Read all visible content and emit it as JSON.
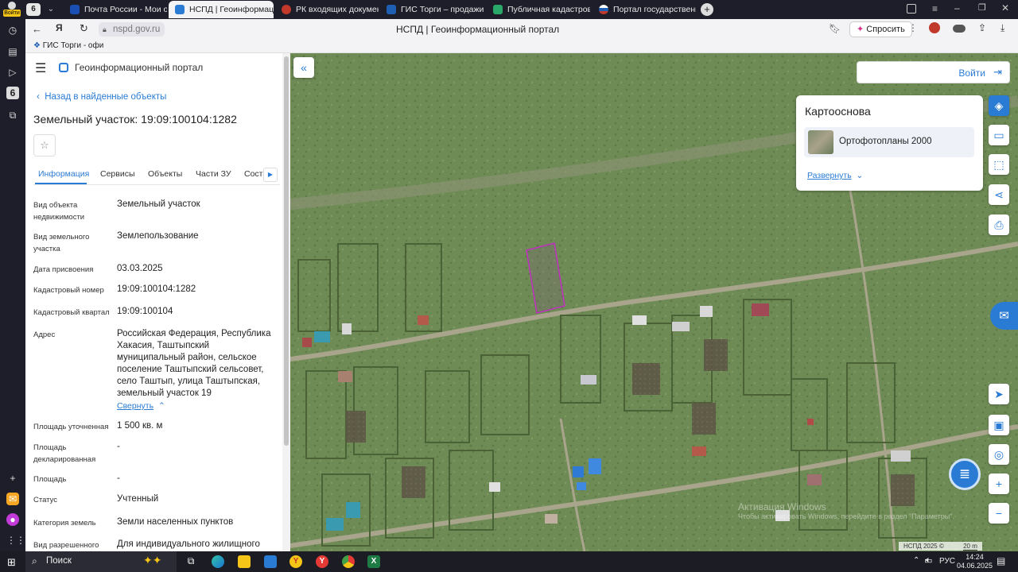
{
  "browser": {
    "tabs": [
      {
        "label": "Почта России - Мои отпр",
        "color": "#1a4fb5"
      },
      {
        "label": "НСПД | Геоинформаци",
        "color": "#2a7bd4",
        "active": true
      },
      {
        "label": "РК входящих документов",
        "color": "#c0392b"
      },
      {
        "label": "ГИС Торги – продажи гос",
        "color": "#1e5fb3"
      },
      {
        "label": "Публичная кадастровая",
        "color": "#2aa86a"
      },
      {
        "label": "Портал государственных",
        "color": "#c0392b"
      }
    ],
    "url": "nspd.gov.ru",
    "title": "НСПД | Геоинформационный портал",
    "ask_label": "Спросить",
    "bookmark": "ГИС Торги - офи",
    "profile_badge": "Войти",
    "tab_count": "6"
  },
  "portal": {
    "name": "Геоинформационный портал",
    "back_link": "Назад в найденные объекты",
    "object_title": "Земельный участок: 19:09:100104:1282",
    "tabs": [
      "Информация",
      "Сервисы",
      "Объекты",
      "Части ЗУ",
      "Соста"
    ],
    "fields": [
      {
        "label": "Вид объекта недвижимости",
        "value": "Земельный участок"
      },
      {
        "label": "Вид земельного участка",
        "value": "Землепользование"
      },
      {
        "label": "Дата присвоения",
        "value": "03.03.2025"
      },
      {
        "label": "Кадастровый номер",
        "value": "19:09:100104:1282"
      },
      {
        "label": "Кадастровый квартал",
        "value": "19:09:100104"
      },
      {
        "label": "Адрес",
        "value": "Российская Федерация, Республика Хакасия, Таштыпский муниципальный район, сельское поселение Таштыпский сельсовет, село Таштып, улица Таштыпская, земельный участок 19"
      },
      {
        "label": "Площадь уточненная",
        "value": "1 500 кв. м"
      },
      {
        "label": "Площадь декларированная",
        "value": "-"
      },
      {
        "label": "Площадь",
        "value": "-"
      },
      {
        "label": "Статус",
        "value": "Учтенный"
      },
      {
        "label": "Категория земель",
        "value": "Земли населенных пунктов"
      },
      {
        "label": "Вид разрешенного",
        "value": "Для индивидуального жилищного"
      }
    ],
    "collapse_link": "Свернуть"
  },
  "map": {
    "login_label": "Войти",
    "basemap_title": "Картооснова",
    "basemap_layer": "Ортофотопланы 2000",
    "expand_link": "Развернуть",
    "attribution": "НСПД 2025 ©",
    "scale": "20 m",
    "watermark_line1": "Активация Windows",
    "watermark_line2": "Чтобы активировать Windows, перейдите в раздел \"Параметры\"."
  },
  "taskbar": {
    "search_label": "Поиск",
    "lang": "РУС",
    "time": "14:24",
    "date": "04.06.2025"
  }
}
